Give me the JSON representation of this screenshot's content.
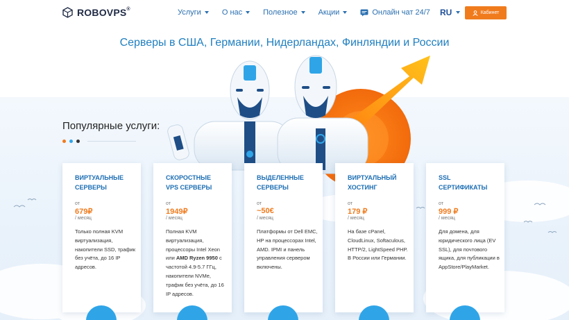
{
  "header": {
    "logo": "ROBOVPS",
    "logo_mark": "®",
    "nav": [
      {
        "label": "Услуги"
      },
      {
        "label": "О нас"
      },
      {
        "label": "Полезное"
      },
      {
        "label": "Акции"
      }
    ],
    "chat_label": "Онлайн чат 24/7",
    "lang": "RU",
    "cabinet_label": "Кабинет"
  },
  "hero": {
    "title": "Серверы в США, Германии, Нидерландах, Финляндии и России"
  },
  "popular": {
    "title": "Популярные услуги:"
  },
  "cards": [
    {
      "t1": "ВИРТУАЛЬНЫЕ",
      "t2": "СЕРВЕРЫ",
      "from": "от",
      "price": "679₽",
      "per": "/ месяц",
      "desc": "Только полная KVM виртуализация, накопители SSD, трафик без учёта, до 16 IP адресов."
    },
    {
      "t1": "СКОРОСТНЫЕ",
      "t2": "VPS СЕРВЕРЫ",
      "from": "от",
      "price": "1949₽",
      "per": "/ месяц",
      "desc_a": "Полная KVM виртуализация, процессоры Intel Xeon или ",
      "desc_b": "AMD Ryzen 9950",
      "desc_c": " с частотой 4.9-5.7 ГГц, накопители NVMe, трафик без учёта, до 16 IP адресов."
    },
    {
      "t1": "ВЫДЕЛЕННЫЕ",
      "t2": "СЕРВЕРЫ",
      "from": "от",
      "price": "~50€",
      "per": "/ месяц",
      "desc": "Платформы от Dell EMC, HP на процессорах Intel, AMD. IPMI и панель управления сервером включены."
    },
    {
      "t1": "ВИРТУАЛЬНЫЙ",
      "t2": "ХОСТИНГ",
      "from": "от",
      "price": "179 ₽",
      "per": "/ месяц",
      "desc": "На базе cPanel, CloudLinux, Softaculous, HTTP/2, LightSpeed PHP. В России или Германии."
    },
    {
      "t1": "SSL",
      "t2": "СЕРТИФИКАТЫ",
      "from": "от",
      "price": "999 ₽",
      "per": "/ месяц",
      "desc": "Для домена, для юридического лица (EV SSL), для почтового ящика, для публикации в AppStore/PlayMarket."
    }
  ],
  "colors": {
    "accent": "#f07b1d",
    "link": "#2a6fb0",
    "title_blue": "#1f7fc0",
    "dot_orange": "#f07b1d",
    "dot_blue": "#2fa5e8",
    "dot_dark": "#333333"
  }
}
